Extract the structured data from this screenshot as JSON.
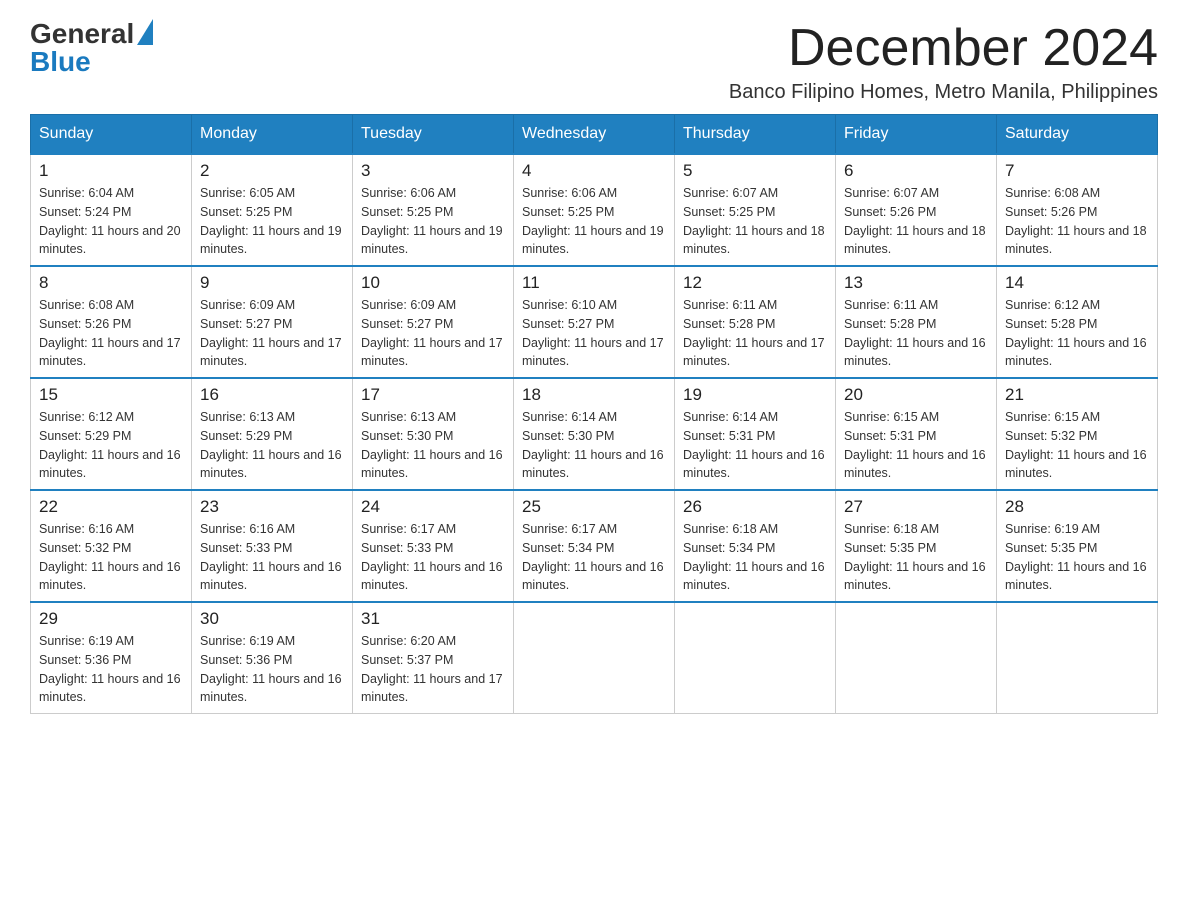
{
  "header": {
    "logo_general": "General",
    "logo_blue": "Blue",
    "month_title": "December 2024",
    "location": "Banco Filipino Homes, Metro Manila, Philippines"
  },
  "days_of_week": [
    "Sunday",
    "Monday",
    "Tuesday",
    "Wednesday",
    "Thursday",
    "Friday",
    "Saturday"
  ],
  "weeks": [
    [
      {
        "day": "1",
        "sunrise": "6:04 AM",
        "sunset": "5:24 PM",
        "daylight": "11 hours and 20 minutes."
      },
      {
        "day": "2",
        "sunrise": "6:05 AM",
        "sunset": "5:25 PM",
        "daylight": "11 hours and 19 minutes."
      },
      {
        "day": "3",
        "sunrise": "6:06 AM",
        "sunset": "5:25 PM",
        "daylight": "11 hours and 19 minutes."
      },
      {
        "day": "4",
        "sunrise": "6:06 AM",
        "sunset": "5:25 PM",
        "daylight": "11 hours and 19 minutes."
      },
      {
        "day": "5",
        "sunrise": "6:07 AM",
        "sunset": "5:25 PM",
        "daylight": "11 hours and 18 minutes."
      },
      {
        "day": "6",
        "sunrise": "6:07 AM",
        "sunset": "5:26 PM",
        "daylight": "11 hours and 18 minutes."
      },
      {
        "day": "7",
        "sunrise": "6:08 AM",
        "sunset": "5:26 PM",
        "daylight": "11 hours and 18 minutes."
      }
    ],
    [
      {
        "day": "8",
        "sunrise": "6:08 AM",
        "sunset": "5:26 PM",
        "daylight": "11 hours and 17 minutes."
      },
      {
        "day": "9",
        "sunrise": "6:09 AM",
        "sunset": "5:27 PM",
        "daylight": "11 hours and 17 minutes."
      },
      {
        "day": "10",
        "sunrise": "6:09 AM",
        "sunset": "5:27 PM",
        "daylight": "11 hours and 17 minutes."
      },
      {
        "day": "11",
        "sunrise": "6:10 AM",
        "sunset": "5:27 PM",
        "daylight": "11 hours and 17 minutes."
      },
      {
        "day": "12",
        "sunrise": "6:11 AM",
        "sunset": "5:28 PM",
        "daylight": "11 hours and 17 minutes."
      },
      {
        "day": "13",
        "sunrise": "6:11 AM",
        "sunset": "5:28 PM",
        "daylight": "11 hours and 16 minutes."
      },
      {
        "day": "14",
        "sunrise": "6:12 AM",
        "sunset": "5:28 PM",
        "daylight": "11 hours and 16 minutes."
      }
    ],
    [
      {
        "day": "15",
        "sunrise": "6:12 AM",
        "sunset": "5:29 PM",
        "daylight": "11 hours and 16 minutes."
      },
      {
        "day": "16",
        "sunrise": "6:13 AM",
        "sunset": "5:29 PM",
        "daylight": "11 hours and 16 minutes."
      },
      {
        "day": "17",
        "sunrise": "6:13 AM",
        "sunset": "5:30 PM",
        "daylight": "11 hours and 16 minutes."
      },
      {
        "day": "18",
        "sunrise": "6:14 AM",
        "sunset": "5:30 PM",
        "daylight": "11 hours and 16 minutes."
      },
      {
        "day": "19",
        "sunrise": "6:14 AM",
        "sunset": "5:31 PM",
        "daylight": "11 hours and 16 minutes."
      },
      {
        "day": "20",
        "sunrise": "6:15 AM",
        "sunset": "5:31 PM",
        "daylight": "11 hours and 16 minutes."
      },
      {
        "day": "21",
        "sunrise": "6:15 AM",
        "sunset": "5:32 PM",
        "daylight": "11 hours and 16 minutes."
      }
    ],
    [
      {
        "day": "22",
        "sunrise": "6:16 AM",
        "sunset": "5:32 PM",
        "daylight": "11 hours and 16 minutes."
      },
      {
        "day": "23",
        "sunrise": "6:16 AM",
        "sunset": "5:33 PM",
        "daylight": "11 hours and 16 minutes."
      },
      {
        "day": "24",
        "sunrise": "6:17 AM",
        "sunset": "5:33 PM",
        "daylight": "11 hours and 16 minutes."
      },
      {
        "day": "25",
        "sunrise": "6:17 AM",
        "sunset": "5:34 PM",
        "daylight": "11 hours and 16 minutes."
      },
      {
        "day": "26",
        "sunrise": "6:18 AM",
        "sunset": "5:34 PM",
        "daylight": "11 hours and 16 minutes."
      },
      {
        "day": "27",
        "sunrise": "6:18 AM",
        "sunset": "5:35 PM",
        "daylight": "11 hours and 16 minutes."
      },
      {
        "day": "28",
        "sunrise": "6:19 AM",
        "sunset": "5:35 PM",
        "daylight": "11 hours and 16 minutes."
      }
    ],
    [
      {
        "day": "29",
        "sunrise": "6:19 AM",
        "sunset": "5:36 PM",
        "daylight": "11 hours and 16 minutes."
      },
      {
        "day": "30",
        "sunrise": "6:19 AM",
        "sunset": "5:36 PM",
        "daylight": "11 hours and 16 minutes."
      },
      {
        "day": "31",
        "sunrise": "6:20 AM",
        "sunset": "5:37 PM",
        "daylight": "11 hours and 17 minutes."
      },
      null,
      null,
      null,
      null
    ]
  ]
}
